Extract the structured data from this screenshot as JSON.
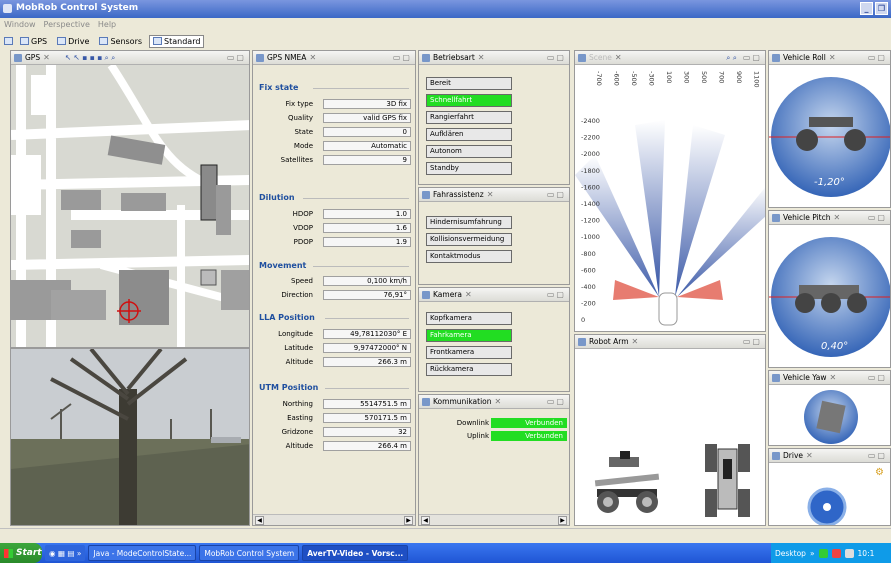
{
  "window": {
    "title": "MobRob Control System"
  },
  "menu": [
    "Window",
    "Perspective",
    "Help"
  ],
  "perspectives": [
    {
      "label": "GPS"
    },
    {
      "label": "Drive"
    },
    {
      "label": "Sensors"
    },
    {
      "label": "Standard"
    }
  ],
  "gps_view": {
    "title": "GPS"
  },
  "nmea": {
    "title": "GPS NMEA",
    "fix_state": {
      "heading": "Fix state",
      "rows": [
        [
          "Fix type",
          "3D fix"
        ],
        [
          "Quality",
          "valid GPS fix"
        ],
        [
          "State",
          "0"
        ],
        [
          "Mode",
          "Automatic"
        ],
        [
          "Satellites",
          "9"
        ]
      ]
    },
    "dilution": {
      "heading": "Dilution",
      "rows": [
        [
          "HDOP",
          "1.0"
        ],
        [
          "VDOP",
          "1.6"
        ],
        [
          "PDOP",
          "1.9"
        ]
      ]
    },
    "movement": {
      "heading": "Movement",
      "rows": [
        [
          "Speed",
          "0,100 km/h"
        ],
        [
          "Direction",
          "76,91°"
        ]
      ]
    },
    "lla": {
      "heading": "LLA Position",
      "rows": [
        [
          "Longitude",
          "49,78112030° E"
        ],
        [
          "Latitude",
          "9,97472000° N"
        ],
        [
          "Altitude",
          "266.3 m"
        ]
      ]
    },
    "utm": {
      "heading": "UTM Position",
      "rows": [
        [
          "Northing",
          "5514751.5 m"
        ],
        [
          "Easting",
          "570171.5 m"
        ],
        [
          "Gridzone",
          "32"
        ],
        [
          "Altitude",
          "266.4 m"
        ]
      ]
    }
  },
  "betriebsart": {
    "title": "Betriebsart",
    "items": [
      "Bereit",
      "Schnellfahrt",
      "Rangierfahrt",
      "Aufklären",
      "Autonom",
      "Standby"
    ],
    "active": 1
  },
  "fahrassistenz": {
    "title": "Fahrassistenz",
    "items": [
      "Hindernisumfahrung",
      "Kollisionsvermeidung",
      "Kontaktmodus"
    ]
  },
  "kamera": {
    "title": "Kamera",
    "items": [
      "Kopfkamera",
      "Fahrkamera",
      "Frontkamera",
      "Rückkamera"
    ],
    "active": 1
  },
  "kommunikation": {
    "title": "Kommunikation",
    "rows": [
      [
        "Downlink",
        "Verbunden"
      ],
      [
        "Uplink",
        "Verbunden"
      ]
    ]
  },
  "scene": {
    "title": "Scene",
    "x_ticks": [
      "-700",
      "-600",
      "-500",
      "-300",
      "100",
      "300",
      "500",
      "700",
      "900",
      "1100"
    ],
    "y_ticks": [
      "-2400",
      "-2200",
      "-2000",
      "-1800",
      "-1600",
      "-1400",
      "-1200",
      "-1000",
      "-800",
      "-600",
      "-400",
      "-200",
      "0",
      "200"
    ]
  },
  "robot_arm": {
    "title": "Robot Arm"
  },
  "roll": {
    "title": "Vehicle Roll",
    "value": "-1,20°"
  },
  "pitch": {
    "title": "Vehicle Pitch",
    "value": "0,40°"
  },
  "yaw": {
    "title": "Vehicle Yaw"
  },
  "drive": {
    "title": "Drive"
  },
  "taskbar": {
    "start": "Start",
    "items": [
      "Java - ModeControlState...",
      "MobRob Control System",
      "AverTV-Video - Vorsc..."
    ],
    "desktop": "Desktop",
    "clock": "10:1"
  },
  "colors": {
    "active": "#22dd22",
    "title": "#3b68c6",
    "section": "#1f4f9f"
  }
}
